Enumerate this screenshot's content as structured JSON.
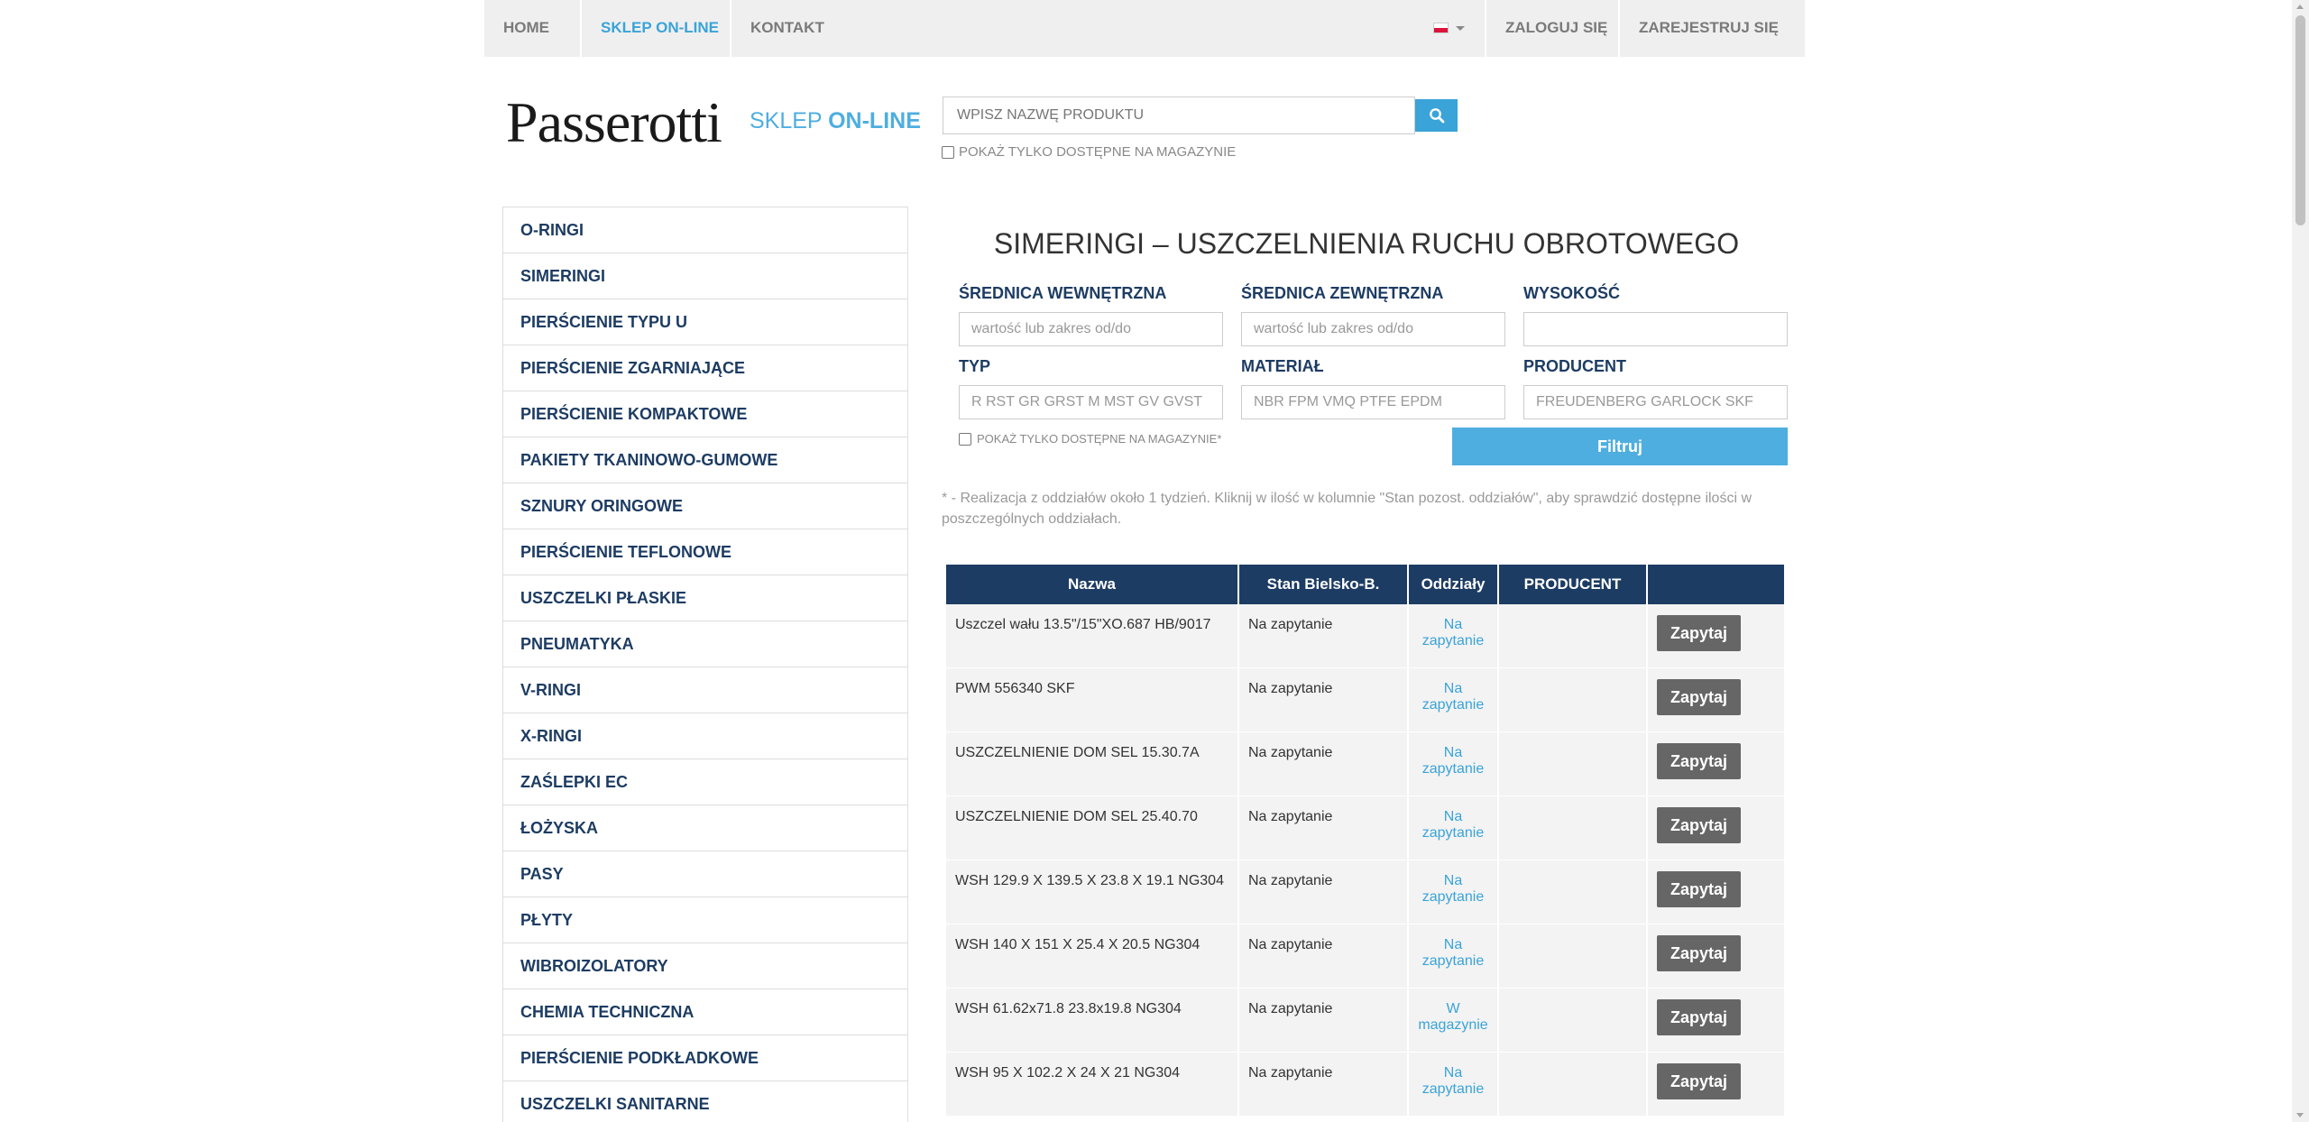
{
  "nav": {
    "home": "HOME",
    "shop": "SKLEP ON-LINE",
    "contact": "KONTAKT",
    "login": "ZALOGUJ SIĘ",
    "register": "ZAREJESTRUJ SIĘ",
    "language_flag": "flag-pl-icon"
  },
  "logo": {
    "brand": "Passerotti",
    "sub_light": "SKLEP ",
    "sub_bold": "ON-LINE"
  },
  "search": {
    "placeholder": "WPISZ NAZWĘ PRODUKTU",
    "icon": "search-icon",
    "stock_only_label": "POKAŻ TYLKO DOSTĘPNE NA MAGAZYNIE"
  },
  "sidebar": {
    "items": [
      {
        "label": "O-RINGI"
      },
      {
        "label": "SIMERINGI"
      },
      {
        "label": "PIERŚCIENIE TYPU U"
      },
      {
        "label": "PIERŚCIENIE ZGARNIAJĄCE"
      },
      {
        "label": "PIERŚCIENIE KOMPAKTOWE"
      },
      {
        "label": "PAKIETY TKANINOWO-GUMOWE"
      },
      {
        "label": "SZNURY ORINGOWE"
      },
      {
        "label": "PIERŚCIENIE TEFLONOWE"
      },
      {
        "label": "USZCZELKI PŁASKIE"
      },
      {
        "label": "PNEUMATYKA"
      },
      {
        "label": "V-RINGI"
      },
      {
        "label": "X-RINGI"
      },
      {
        "label": "ZAŚLEPKI EC"
      },
      {
        "label": "ŁOŻYSKA"
      },
      {
        "label": "PASY"
      },
      {
        "label": "PŁYTY"
      },
      {
        "label": "WIBROIZOLATORY"
      },
      {
        "label": "CHEMIA TECHNICZNA"
      },
      {
        "label": "PIERŚCIENIE PODKŁADKOWE"
      },
      {
        "label": "USZCZELKI SANITARNE"
      }
    ]
  },
  "main": {
    "title": "SIMERINGI – USZCZELNIENIA RUCHU OBROTOWEGO",
    "filters": {
      "inner_label": "ŚREDNICA WEWNĘTRZNA",
      "inner_placeholder": "wartość lub zakres od/do",
      "outer_label": "ŚREDNICA ZEWNĘTRZNA",
      "outer_placeholder": "wartość lub zakres od/do",
      "height_label": "WYSOKOŚĆ",
      "height_placeholder": "",
      "type_label": "TYP",
      "type_placeholder": "R RST GR GRST M MST GV GVST",
      "material_label": "MATERIAŁ",
      "material_placeholder": "NBR FPM VMQ PTFE EPDM",
      "producer_label": "PRODUCENT",
      "producer_placeholder": "FREUDENBERG GARLOCK SKF",
      "stock_only_label": "POKAŻ TYLKO DOSTĘPNE NA MAGAZYNIE*",
      "filter_button": "Filtruj"
    },
    "note": "* - Realizacja z oddziałów około 1 tydzień. Kliknij w ilość w kolumnie \"Stan pozost. oddziałów\", aby sprawdzić dostępne ilości w poszczególnych oddziałach.",
    "table": {
      "headers": [
        "Nazwa",
        "Stan Bielsko-B.",
        "Oddziały",
        "PRODUCENT",
        ""
      ],
      "rows": [
        {
          "name": "Uszczel wału 13.5\"/15\"XO.687 HB/9017",
          "stock": "Na zapytanie",
          "dept_1": "Na",
          "dept_2": "zapytanie",
          "producer": "",
          "action": "Zapytaj"
        },
        {
          "name": "PWM 556340 SKF",
          "stock": "Na zapytanie",
          "dept_1": "Na",
          "dept_2": "zapytanie",
          "producer": "",
          "action": "Zapytaj"
        },
        {
          "name": "USZCZELNIENIE DOM SEL 15.30.7A",
          "stock": "Na zapytanie",
          "dept_1": "Na",
          "dept_2": "zapytanie",
          "producer": "",
          "action": "Zapytaj"
        },
        {
          "name": "USZCZELNIENIE DOM SEL 25.40.70",
          "stock": "Na zapytanie",
          "dept_1": "Na",
          "dept_2": "zapytanie",
          "producer": "",
          "action": "Zapytaj"
        },
        {
          "name": "WSH 129.9 X 139.5 X 23.8 X 19.1 NG304",
          "stock": "Na zapytanie",
          "dept_1": "Na",
          "dept_2": "zapytanie",
          "producer": "",
          "action": "Zapytaj"
        },
        {
          "name": "WSH 140 X 151 X 25.4 X 20.5 NG304",
          "stock": "Na zapytanie",
          "dept_1": "Na",
          "dept_2": "zapytanie",
          "producer": "",
          "action": "Zapytaj"
        },
        {
          "name": "WSH 61.62x71.8 23.8x19.8 NG304",
          "stock": "Na zapytanie",
          "dept_1": "W",
          "dept_2": "magazynie",
          "producer": "",
          "action": "Zapytaj"
        },
        {
          "name": "WSH 95 X 102.2 X 24 X 21 NG304",
          "stock": "Na zapytanie",
          "dept_1": "Na",
          "dept_2": "zapytanie",
          "producer": "",
          "action": "Zapytaj"
        }
      ]
    }
  },
  "colors": {
    "navy": "#1d3c63",
    "accent_blue": "#3aa3d8",
    "button_gray": "#666666",
    "nav_bg": "#efefef"
  }
}
